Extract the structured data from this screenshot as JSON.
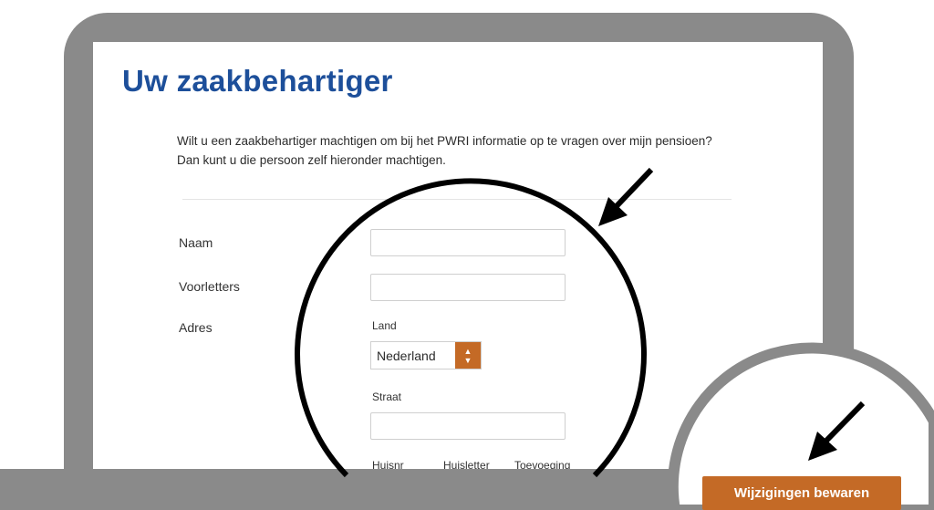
{
  "page": {
    "title": "Uw zaakbehartiger",
    "intro": "Wilt u een zaakbehartiger machtigen om bij het PWRI informatie op te vragen over mijn pensioen? Dan kunt u die persoon zelf hieronder machtigen."
  },
  "form": {
    "naam_label": "Naam",
    "voorletters_label": "Voorletters",
    "adres_label": "Adres",
    "land_label": "Land",
    "land_value": "Nederland",
    "straat_label": "Straat",
    "huisnummer_label": "Huisnr",
    "huisletter_label": "Huisletter",
    "toevoeging_label": "Toevoeging",
    "save_label": "Wijzigingen bewaren"
  },
  "colors": {
    "title_blue": "#1d4f9a",
    "accent_orange": "#c46a26",
    "frame_gray": "#8a8a8a"
  },
  "icons": {
    "select_toggle": "updown-arrows-icon",
    "annotation_arrow": "arrow-icon"
  }
}
